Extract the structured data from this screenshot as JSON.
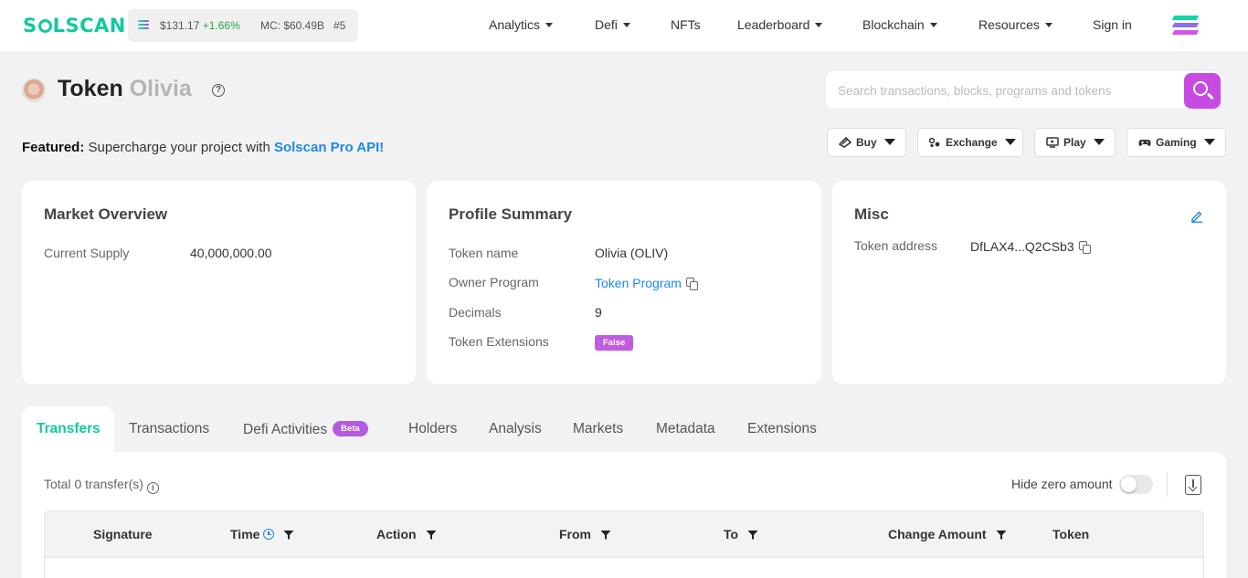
{
  "header": {
    "logo": "SOLSCAN",
    "price": "$131.17",
    "change": "+1.66%",
    "market_cap": "MC: $60.49B",
    "rank": "#5",
    "nav": [
      "Analytics",
      "Defi",
      "NFTs",
      "Leaderboard",
      "Blockchain",
      "Resources",
      "Sign in"
    ],
    "accent": "#14c8a0"
  },
  "title": {
    "prefix": "Token",
    "name": "Olivia",
    "help_glyph": "?"
  },
  "search": {
    "placeholder": "Search transactions, blocks, programs and tokens"
  },
  "featured": {
    "label": "Featured:",
    "text": "Supercharge your project with",
    "link": "Solscan Pro API!"
  },
  "chips": [
    "Buy",
    "Exchange",
    "Play",
    "Gaming"
  ],
  "market_overview": {
    "title": "Market Overview",
    "supply_label": "Current Supply",
    "supply_value": "40,000,000.00"
  },
  "profile_summary": {
    "title": "Profile Summary",
    "rows": [
      {
        "label": "Token name",
        "value": "Olivia (OLIV)"
      },
      {
        "label": "Owner Program",
        "value": "Token Program"
      },
      {
        "label": "Decimals",
        "value": "9"
      },
      {
        "label": "Token Extensions",
        "value": "False"
      }
    ]
  },
  "misc": {
    "title": "Misc",
    "address_label": "Token address",
    "address_value": "DfLAX4...Q2CSb3"
  },
  "tabs": {
    "items": [
      "Transfers",
      "Transactions",
      "Defi Activities",
      "Holders",
      "Analysis",
      "Markets",
      "Metadata",
      "Extensions"
    ],
    "beta": "Beta",
    "active": "Transfers"
  },
  "transfers": {
    "total": "Total 0 transfer(s)",
    "info_glyph": "i",
    "hide_zero_label": "Hide zero amount",
    "hide_zero_enabled": false,
    "columns": [
      "Signature",
      "Time",
      "Action",
      "From",
      "To",
      "Change Amount",
      "Token"
    ]
  }
}
